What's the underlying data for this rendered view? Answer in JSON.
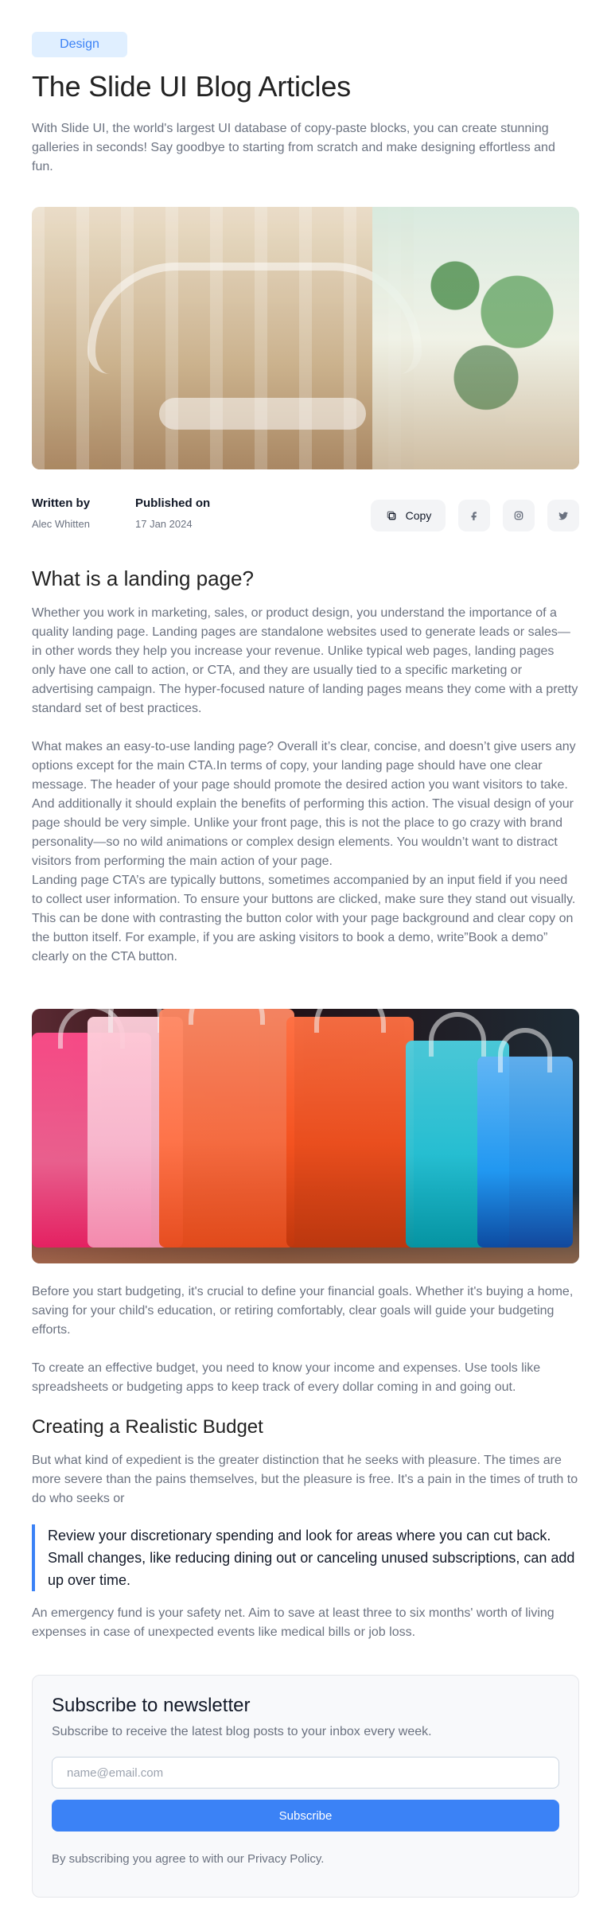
{
  "header": {
    "badge": "Design",
    "title": "The Slide UI Blog Articles",
    "lead": "With Slide UI, the world's largest UI database of copy-paste blocks, you can create stunning galleries in seconds! Say goodbye to starting from scratch and make designing effortless and fun."
  },
  "meta": {
    "written_by_label": "Written by",
    "written_by_value": "Alec Whitten",
    "published_on_label": "Published on",
    "published_on_value": "17 Jan 2024",
    "copy_label": "Copy",
    "icons": {
      "copy": "copy-icon",
      "facebook": "facebook-icon",
      "instagram": "instagram-icon",
      "twitter": "twitter-icon"
    }
  },
  "article": {
    "h_landing": "What is a landing page?",
    "p_landing_1": "Whether you work in marketing, sales, or product design, you understand the importance of a quality landing page. Landing pages are standalone websites used to generate leads or sales—in other words they help you increase your revenue. Unlike typical web pages, landing pages only have one call to action, or CTA, and they are usually tied to a specific marketing or advertising campaign. The hyper-focused nature of landing pages means they come with a pretty standard set of best practices.",
    "p_landing_2": "What makes an easy-to-use landing page? Overall it’s clear, concise, and doesn’t give users any options except for the main CTA.In terms of copy, your landing page should have one clear message. The header of your page should promote the desired action you want visitors to take. And additionally it should explain the benefits of performing this action. The visual design of your page should be very simple. Unlike your front page, this is not the place to go crazy with brand personality—so no wild animations or complex design elements. You wouldn’t want to distract visitors from performing the main action of your page.",
    "p_landing_3": "Landing page CTA’s are typically buttons, sometimes accompanied by an input field if you need to collect user information. To ensure your buttons are clicked, make sure they stand out visually. This can be done with contrasting the button color with your page background and clear copy on the button itself. For example, if you are asking visitors to book a demo, write”Book a demo” clearly on the CTA button.",
    "p_budget_1": "Before you start budgeting, it's crucial to define your financial goals. Whether it's buying a home, saving for your child's education, or retiring comfortably, clear goals will guide your budgeting efforts.",
    "p_budget_2": "To create an effective budget, you need to know your income and expenses. Use tools like spreadsheets or budgeting apps to keep track of every dollar coming in and going out.",
    "h_budget": "Creating a Realistic Budget",
    "p_budget_3": "But what kind of expedient is the greater distinction that he seeks with pleasure. The times are more severe than the pains themselves, but the pleasure is free. It's a pain in the times of truth to do who seeks or",
    "quote": "Review your discretionary spending and look for areas where you can cut back. Small changes, like reducing dining out or canceling unused subscriptions, can add up over time.",
    "p_budget_4": "An emergency fund is your safety net. Aim to save at least three to six months' worth of living expenses in case of unexpected events like medical bills or job loss."
  },
  "newsletter": {
    "title": "Subscribe to newsletter",
    "subtitle": "Subscribe to receive the latest blog posts to your inbox every week.",
    "placeholder": "name@email.com",
    "button": "Subscribe",
    "legal": "By subscribing you agree to with our Privacy Policy."
  },
  "colors": {
    "accent": "#3b82f6",
    "badge_bg": "#e0efff",
    "muted_text": "#6b7280"
  }
}
